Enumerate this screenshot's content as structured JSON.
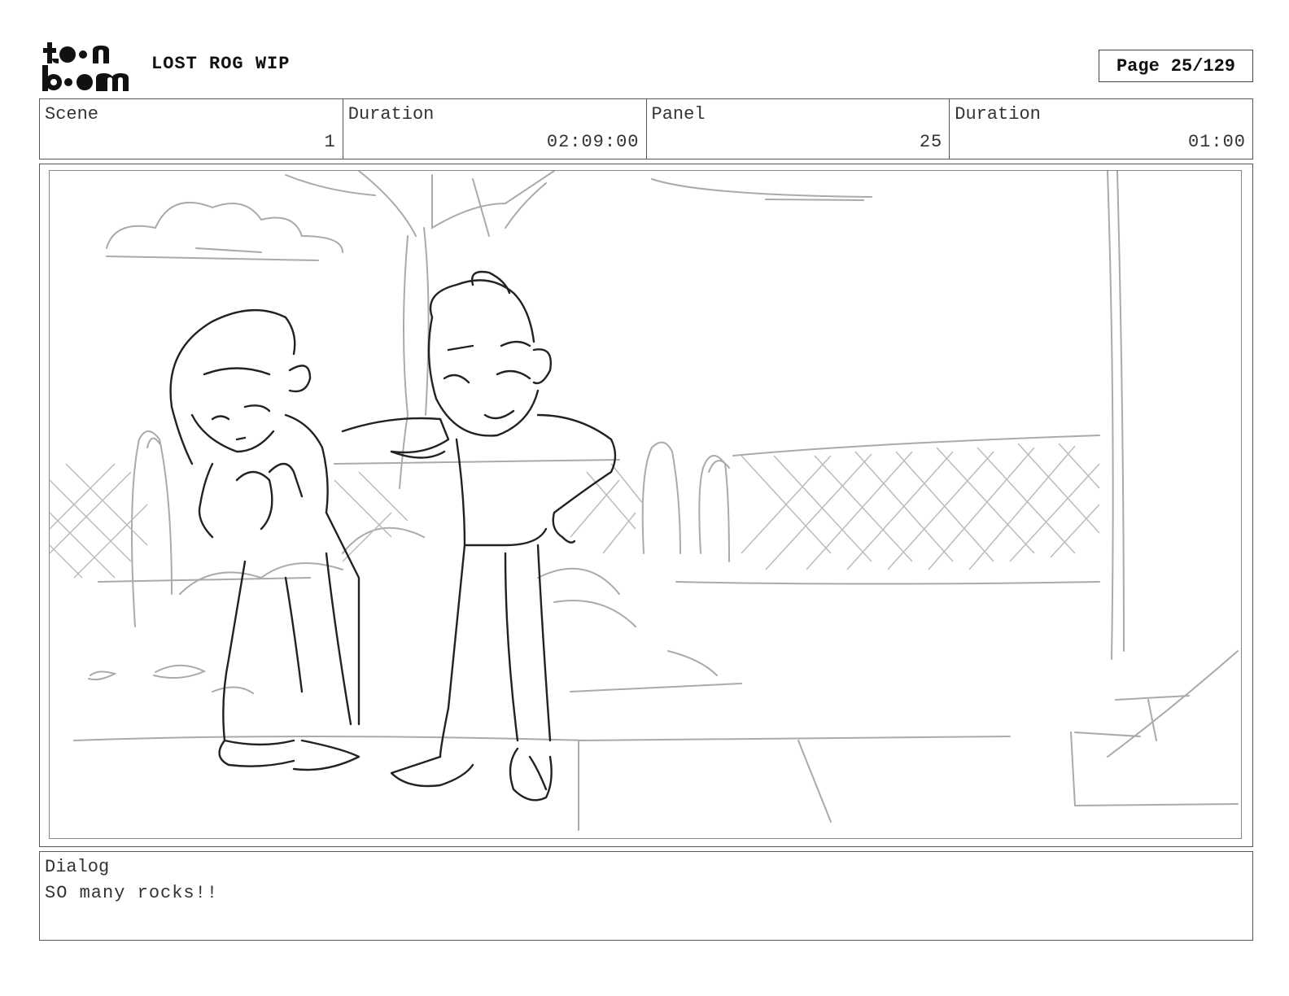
{
  "header": {
    "logo_text": "toon boom",
    "project_title": "LOST ROG WIP",
    "page_label": "Page",
    "page_number": "25/129"
  },
  "info": {
    "scene_label": "Scene",
    "scene_value": "1",
    "scene_duration_label": "Duration",
    "scene_duration_value": "02:09:00",
    "panel_label": "Panel",
    "panel_value": "25",
    "panel_duration_label": "Duration",
    "panel_duration_value": "01:00"
  },
  "dialog": {
    "label": "Dialog",
    "text": "SO many rocks!!"
  }
}
